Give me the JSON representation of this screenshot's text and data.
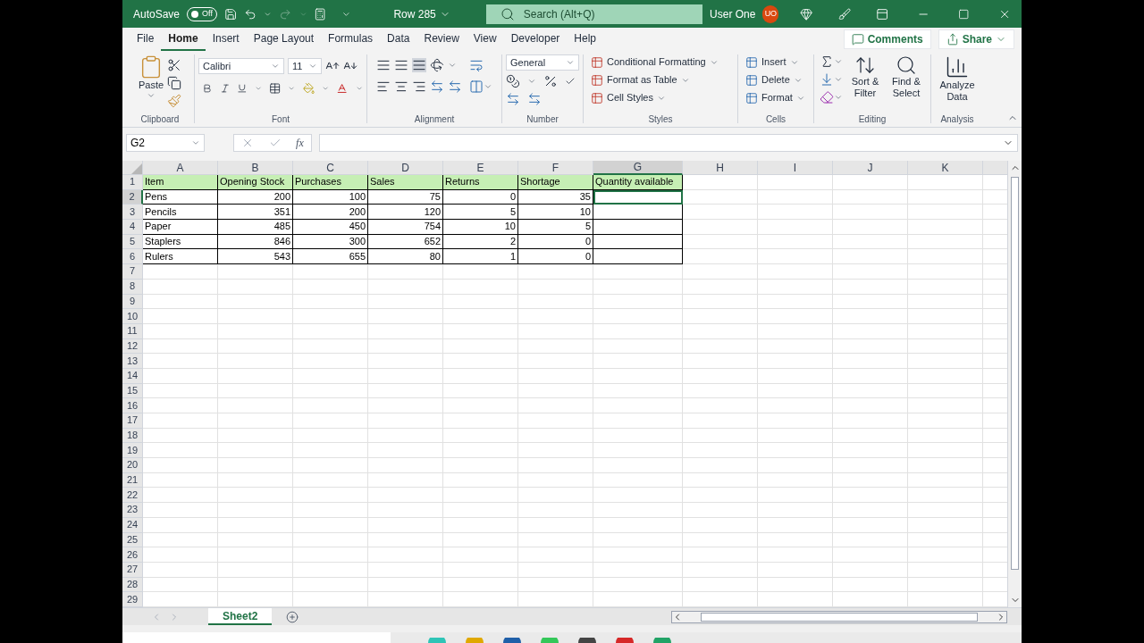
{
  "title_bar": {
    "autosave": {
      "label": "AutoSave",
      "toggle": "Off",
      "on": false
    },
    "title": "Row 285",
    "search": {
      "placeholder": "Search (Alt+Q)"
    },
    "user": {
      "name": "User One",
      "initials": "UO"
    }
  },
  "ribbon_tabs": [
    {
      "label": "File",
      "selected": false
    },
    {
      "label": "Home",
      "selected": true
    },
    {
      "label": "Insert",
      "selected": false
    },
    {
      "label": "Page Layout",
      "selected": false
    },
    {
      "label": "Formulas",
      "selected": false
    },
    {
      "label": "Data",
      "selected": false
    },
    {
      "label": "Review",
      "selected": false
    },
    {
      "label": "View",
      "selected": false
    },
    {
      "label": "Developer",
      "selected": false
    },
    {
      "label": "Help",
      "selected": false
    }
  ],
  "ribbon_buttons": {
    "comments": "Comments",
    "share": "Share"
  },
  "ribbon": {
    "clipboard": {
      "label": "Clipboard",
      "paste": "Paste"
    },
    "font": {
      "label": "Font",
      "name": "Calibri",
      "size": "11"
    },
    "alignment": {
      "label": "Alignment"
    },
    "number": {
      "label": "Number",
      "format": "General"
    },
    "styles": {
      "label": "Styles",
      "items": [
        "Conditional Formatting",
        "Format as Table",
        "Cell Styles"
      ]
    },
    "cells": {
      "label": "Cells",
      "items": [
        "Insert",
        "Delete",
        "Format"
      ]
    },
    "editing": {
      "label": "Editing",
      "sort": "Sort & Filter",
      "find": "Find & Select"
    },
    "analysis": {
      "label": "Analysis",
      "button": "Analyze Data"
    }
  },
  "formula_bar": {
    "name_box": "G2",
    "function_symbol": "fx"
  },
  "grid": {
    "columns": [
      {
        "label": "A",
        "selected": false
      },
      {
        "label": "B",
        "selected": false
      },
      {
        "label": "C",
        "selected": false
      },
      {
        "label": "D",
        "selected": false
      },
      {
        "label": "E",
        "selected": false
      },
      {
        "label": "F",
        "selected": false
      },
      {
        "label": "G",
        "selected": true
      },
      {
        "label": "H",
        "selected": false
      },
      {
        "label": "I",
        "selected": false
      },
      {
        "label": "J",
        "selected": false
      },
      {
        "label": "K",
        "selected": false
      }
    ],
    "rows": [
      {
        "number": "1",
        "selected": false,
        "kind": "header",
        "cells": [
          "Item",
          "Opening Stock",
          "Purchases",
          "Sales",
          "Returns",
          "Shortage",
          "Quantity available"
        ]
      },
      {
        "number": "2",
        "selected": true,
        "kind": "data",
        "cells": [
          "Pens",
          "200",
          "100",
          "75",
          "0",
          "35"
        ]
      },
      {
        "number": "3",
        "selected": false,
        "kind": "data",
        "cells": [
          "Pencils",
          "351",
          "200",
          "120",
          "5",
          "10"
        ]
      },
      {
        "number": "4",
        "selected": false,
        "kind": "data",
        "cells": [
          "Paper",
          "485",
          "450",
          "754",
          "10",
          "5"
        ]
      },
      {
        "number": "5",
        "selected": false,
        "kind": "data",
        "cells": [
          "Staplers",
          "846",
          "300",
          "652",
          "2",
          "0"
        ]
      },
      {
        "number": "6",
        "selected": false,
        "kind": "data",
        "cells": [
          "Rulers",
          "543",
          "655",
          "80",
          "1",
          "0"
        ]
      },
      {
        "number": "7",
        "selected": false,
        "kind": "empty"
      },
      {
        "number": "8",
        "selected": false,
        "kind": "empty"
      },
      {
        "number": "9",
        "selected": false,
        "kind": "empty"
      },
      {
        "number": "10",
        "selected": false,
        "kind": "empty"
      },
      {
        "number": "11",
        "selected": false,
        "kind": "empty"
      },
      {
        "number": "12",
        "selected": false,
        "kind": "empty"
      },
      {
        "number": "13",
        "selected": false,
        "kind": "empty"
      },
      {
        "number": "14",
        "selected": false,
        "kind": "empty"
      },
      {
        "number": "15",
        "selected": false,
        "kind": "empty"
      },
      {
        "number": "16",
        "selected": false,
        "kind": "empty"
      },
      {
        "number": "17",
        "selected": false,
        "kind": "empty"
      },
      {
        "number": "18",
        "selected": false,
        "kind": "empty"
      },
      {
        "number": "19",
        "selected": false,
        "kind": "empty"
      },
      {
        "number": "20",
        "selected": false,
        "kind": "empty"
      },
      {
        "number": "21",
        "selected": false,
        "kind": "empty"
      },
      {
        "number": "22",
        "selected": false,
        "kind": "empty"
      },
      {
        "number": "23",
        "selected": false,
        "kind": "empty"
      },
      {
        "number": "24",
        "selected": false,
        "kind": "empty"
      },
      {
        "number": "25",
        "selected": false,
        "kind": "empty"
      },
      {
        "number": "26",
        "selected": false,
        "kind": "empty"
      },
      {
        "number": "27",
        "selected": false,
        "kind": "empty"
      },
      {
        "number": "28",
        "selected": false,
        "kind": "empty"
      },
      {
        "number": "29",
        "selected": false,
        "kind": "empty"
      }
    ]
  },
  "sheet_tabs": [
    {
      "label": "Sheet2",
      "selected": true
    }
  ]
}
